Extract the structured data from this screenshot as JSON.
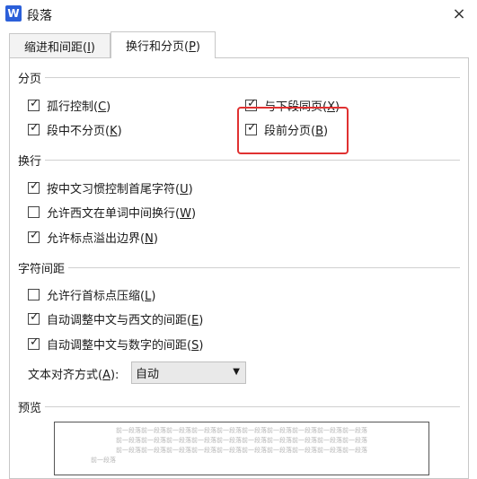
{
  "window": {
    "app_icon_letter": "W",
    "title": "段落",
    "close_glyph": "×"
  },
  "tabs": [
    {
      "label": "缩进和间距(I)",
      "text": "缩进和间距(",
      "key": "I",
      "end": ")",
      "active": false
    },
    {
      "label": "换行和分页(P)",
      "text": "换行和分页(",
      "key": "P",
      "end": ")",
      "active": true
    }
  ],
  "pagination": {
    "title": "分页",
    "widow": {
      "text": "孤行控制(",
      "key": "C",
      "end": ")",
      "checked": true
    },
    "keep_with_next": {
      "text": "与下段同页(",
      "key": "X",
      "end": ")",
      "checked": true
    },
    "keep_together": {
      "text": "段中不分页(",
      "key": "K",
      "end": ")",
      "checked": true
    },
    "page_break_before": {
      "text": "段前分页(",
      "key": "B",
      "end": ")",
      "checked": true
    }
  },
  "line_breaking": {
    "title": "换行",
    "kinsoku": {
      "text": "按中文习惯控制首尾字符(",
      "key": "U",
      "end": ")",
      "checked": true
    },
    "word_wrap": {
      "text": "允许西文在单词中间换行(",
      "key": "W",
      "end": ")",
      "checked": false
    },
    "hanging_punct": {
      "text": "允许标点溢出边界(",
      "key": "N",
      "end": ")",
      "checked": true
    }
  },
  "char_spacing": {
    "title": "字符间距",
    "compress_punct": {
      "text": "允许行首标点压缩(",
      "key": "L",
      "end": ")",
      "checked": false
    },
    "auto_space_west": {
      "text": "自动调整中文与西文的间距(",
      "key": "E",
      "end": ")",
      "checked": true
    },
    "auto_space_num": {
      "text": "自动调整中文与数字的间距(",
      "key": "S",
      "end": ")",
      "checked": true
    },
    "align_label": {
      "text": "文本对齐方式(",
      "key": "A",
      "end": "):"
    },
    "align_value": "自动",
    "dropdown_glyph": "▼"
  },
  "preview": {
    "title": "预览",
    "sample_line": "前一段落前一段落前一段落前一段落前一段落前一段落前一段落前一段落前一段落前一段落",
    "sample_short": "前一段落"
  },
  "check_glyph": "✓",
  "accent_color": "#e03131"
}
